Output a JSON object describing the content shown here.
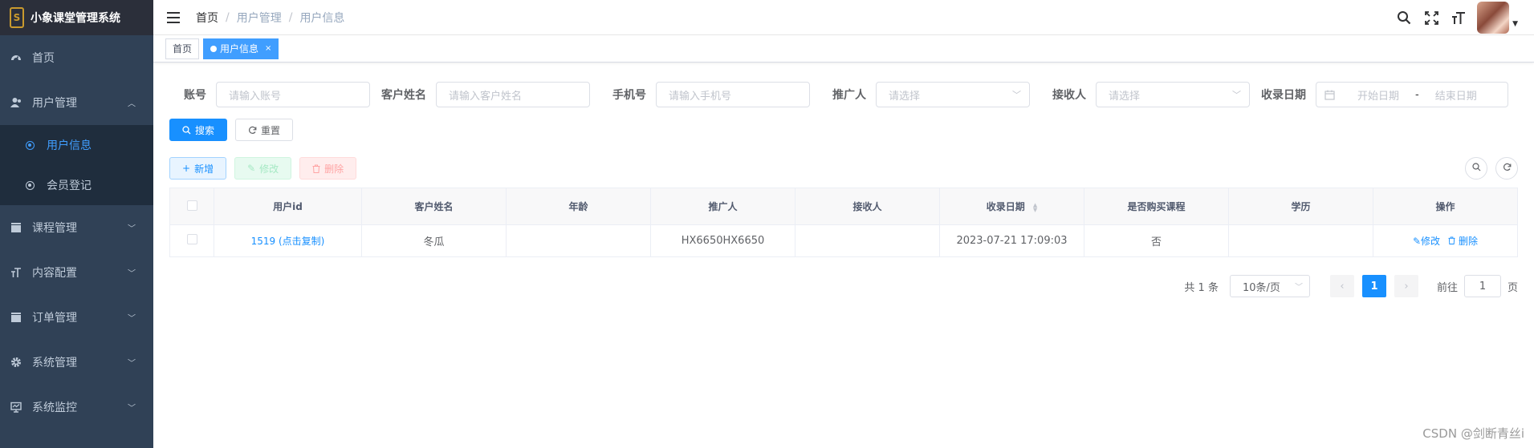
{
  "app": {
    "title": "小象课堂管理系统"
  },
  "sidebar": {
    "items": [
      {
        "label": "首页",
        "icon": "dashboard-icon"
      },
      {
        "label": "用户管理",
        "icon": "user-icon",
        "expanded": true,
        "children": [
          {
            "label": "用户信息",
            "active": true
          },
          {
            "label": "会员登记",
            "active": false
          }
        ]
      },
      {
        "label": "课程管理",
        "icon": "clapper-icon"
      },
      {
        "label": "内容配置",
        "icon": "text-size-icon"
      },
      {
        "label": "订单管理",
        "icon": "clapper-icon"
      },
      {
        "label": "系统管理",
        "icon": "gear-icon"
      },
      {
        "label": "系统监控",
        "icon": "monitor-icon"
      }
    ]
  },
  "navbar": {
    "breadcrumb": [
      "首页",
      "用户管理",
      "用户信息"
    ]
  },
  "tags": [
    {
      "label": "首页",
      "active": false
    },
    {
      "label": "用户信息",
      "active": true,
      "close": "×"
    }
  ],
  "search": {
    "account": {
      "label": "账号",
      "placeholder": "请输入账号"
    },
    "customer_name": {
      "label": "客户姓名",
      "placeholder": "请输入客户姓名"
    },
    "phone": {
      "label": "手机号",
      "placeholder": "请输入手机号"
    },
    "promoter": {
      "label": "推广人",
      "placeholder": "请选择"
    },
    "receiver": {
      "label": "接收人",
      "placeholder": "请选择"
    },
    "date": {
      "label": "收录日期",
      "start_placeholder": "开始日期",
      "separator": "-",
      "end_placeholder": "结束日期"
    },
    "search_btn": "搜索",
    "reset_btn": "重置"
  },
  "toolbar": {
    "add": "新增",
    "edit": "修改",
    "delete": "删除"
  },
  "table": {
    "columns": [
      "用户id",
      "客户姓名",
      "年龄",
      "推广人",
      "接收人",
      "收录日期",
      "是否购买课程",
      "学历",
      "操作"
    ],
    "rows": [
      {
        "id": "1519 (点击复制)",
        "name": "冬瓜",
        "age": "",
        "promoter": "HX6650HX6650",
        "receiver": "",
        "date": "2023-07-21 17:09:03",
        "purchased": "否",
        "education": "",
        "edit": "修改",
        "delete": "删除"
      }
    ]
  },
  "pagination": {
    "total": "共 1 条",
    "page_size": "10条/页",
    "current": "1",
    "goto_prefix": "前往",
    "goto_value": "1",
    "goto_suffix": "页"
  },
  "watermark": "CSDN @剑断青丝i",
  "colors": {
    "primary": "#1890ff",
    "sidebar_bg": "#304156",
    "sidebar_active": "#409eff"
  }
}
